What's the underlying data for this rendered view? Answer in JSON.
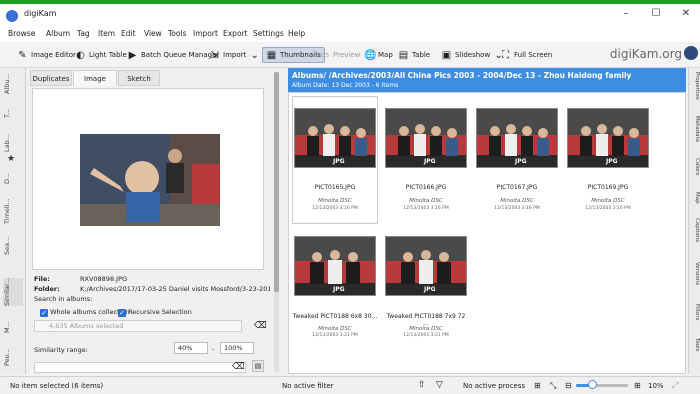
{
  "window": {
    "title": "digiKam",
    "minimize": "–",
    "maximize": "☐",
    "close": "✕"
  },
  "menu": [
    "Browse",
    "Album",
    "Tag",
    "Item",
    "Edit",
    "View",
    "Tools",
    "Import",
    "Export",
    "Settings",
    "Help"
  ],
  "toolbar": {
    "image_editor": "Image Editor",
    "light_table": "Light Table",
    "batch_queue": "Batch Queue Manager",
    "import": "Import",
    "thumbnails": "Thumbnails",
    "preview": "Preview",
    "map": "Map",
    "table": "Table",
    "slideshow": "Slideshow",
    "full_screen": "Full Screen",
    "brand": "digiKam.org"
  },
  "left_tabs": [
    "Albu...",
    "T...",
    "Lab...",
    "D...",
    "Timeli...",
    "Sea...",
    "Similar...",
    "M...",
    "Peo..."
  ],
  "left_panel": {
    "tabs": [
      "Duplicates",
      "Image",
      "Sketch"
    ],
    "file_label": "File:",
    "file_value": "RXV08898.JPG",
    "folder_label": "Folder:",
    "folder_value": "K:/Archives/2017/17-03-25 Daniel visits Mossford/3-23-2017/",
    "search_in_albums": "Search in albums:",
    "whole_albums": "Whole albums collection",
    "recursive": "Recursive Selection",
    "album_select": "4,635 Albums selected",
    "similarity_label": "Similarity range:",
    "sim_min": "40%",
    "sim_sep": "-",
    "sim_max": "100%"
  },
  "main": {
    "album_title": "Albums/ /Archives/2003/All China Pics 2003 - 2004/Dec 13 - Zhou Haidong family",
    "album_subtitle": "Album Date: 13 Dec 2003 - 6 Items",
    "items": [
      {
        "name": "PICT0165.JPG",
        "camera": "Minolta DSC",
        "date": "12/13/2003 3:16 PM",
        "badge": "JPG"
      },
      {
        "name": "PICT0166.JPG",
        "camera": "Minolta DSC",
        "date": "12/13/2003 3:16 PM",
        "badge": "JPG"
      },
      {
        "name": "PICT0167.JPG",
        "camera": "Minolta DSC",
        "date": "12/13/2003 3:16 PM",
        "badge": "JPG"
      },
      {
        "name": "PICT0169.JPG",
        "camera": "Minolta DSC",
        "date": "12/13/2003 3:16 PM",
        "badge": "JPG"
      },
      {
        "name": "Tweaked PICT0188 6x8 30...",
        "camera": "Minolta DSC",
        "date": "12/13/2003 3:21 PM",
        "badge": "JPG"
      },
      {
        "name": "Tweaked PICT0188 7x9 72 ...",
        "camera": "Minolta DSC",
        "date": "12/13/2003 3:21 PM",
        "badge": "JPG"
      }
    ]
  },
  "right_tabs": [
    "Properties",
    "Metadata",
    "Colors",
    "Map",
    "Captions",
    "Versions",
    "Filters",
    "Tools"
  ],
  "status": {
    "selection": "No item selected (6 items)",
    "filter": "No active filter",
    "process": "No active process",
    "zoom": "10%",
    "zoom_level": 0.3
  },
  "colors": {
    "accent": "#3d8ee3",
    "titlebar_border": "#1a9f1a"
  }
}
